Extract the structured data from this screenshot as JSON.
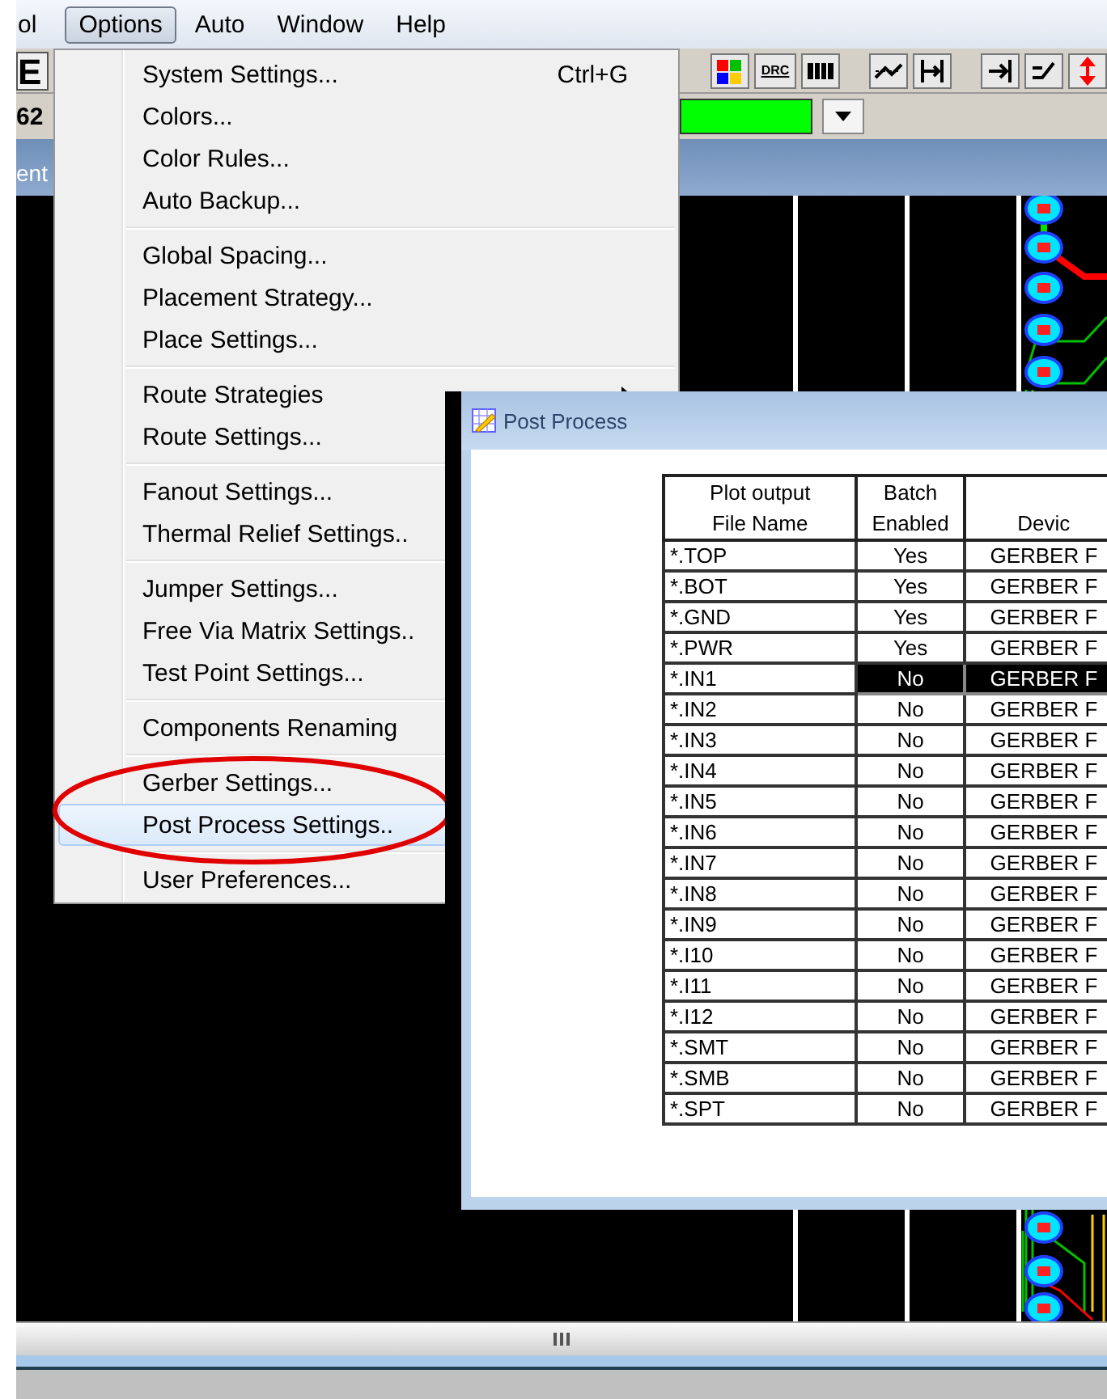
{
  "menubar": [
    {
      "label": "ol",
      "selected": false
    },
    {
      "label": "Options",
      "selected": true
    },
    {
      "label": "Auto",
      "selected": false
    },
    {
      "label": "Window",
      "selected": false
    },
    {
      "label": "Help",
      "selected": false
    }
  ],
  "toolbar": {
    "left_label": "E",
    "drc_label": "DRC"
  },
  "toolbar2": {
    "left_label": "62"
  },
  "document_tab": "ent",
  "options_menu": {
    "groups": [
      [
        {
          "label": "System Settings...",
          "shortcut": "Ctrl+G",
          "submenu": false,
          "selected": false
        },
        {
          "label": "Colors...",
          "submenu": false,
          "selected": false
        },
        {
          "label": "Color Rules...",
          "submenu": false,
          "selected": false
        },
        {
          "label": "Auto Backup...",
          "submenu": false,
          "selected": false
        }
      ],
      [
        {
          "label": "Global Spacing...",
          "submenu": false,
          "selected": false
        },
        {
          "label": "Placement Strategy...",
          "submenu": false,
          "selected": false
        },
        {
          "label": "Place Settings...",
          "submenu": false,
          "selected": false
        }
      ],
      [
        {
          "label": "Route Strategies",
          "submenu": true,
          "selected": false
        },
        {
          "label": "Route Settings...",
          "submenu": false,
          "selected": false
        }
      ],
      [
        {
          "label": "Fanout Settings...",
          "submenu": false,
          "selected": false
        },
        {
          "label": "Thermal Relief Settings..",
          "submenu": false,
          "selected": false
        }
      ],
      [
        {
          "label": "Jumper Settings...",
          "submenu": false,
          "selected": false
        },
        {
          "label": "Free Via Matrix Settings..",
          "submenu": false,
          "selected": false
        },
        {
          "label": "Test Point Settings...",
          "submenu": false,
          "selected": false
        }
      ],
      [
        {
          "label": "Components Renaming",
          "submenu": false,
          "selected": false
        }
      ],
      [
        {
          "label": "Gerber Settings...",
          "submenu": false,
          "selected": false
        },
        {
          "label": "Post Process Settings..",
          "submenu": false,
          "selected": true
        }
      ],
      [
        {
          "label": "User Preferences...",
          "submenu": false,
          "selected": false
        }
      ]
    ]
  },
  "dialog": {
    "title": "Post Process",
    "table": {
      "columns": [
        [
          "Plot output",
          "File Name"
        ],
        [
          "Batch",
          "Enabled"
        ],
        [
          "Devic"
        ]
      ],
      "rows": [
        {
          "file": "*.TOP",
          "batch": "Yes",
          "device": "GERBER F",
          "selected": false
        },
        {
          "file": "*.BOT",
          "batch": "Yes",
          "device": "GERBER F",
          "selected": false
        },
        {
          "file": "*.GND",
          "batch": "Yes",
          "device": "GERBER F",
          "selected": false
        },
        {
          "file": "*.PWR",
          "batch": "Yes",
          "device": "GERBER F",
          "selected": false
        },
        {
          "file": "*.IN1",
          "batch": "No",
          "device": "GERBER F",
          "selected": true
        },
        {
          "file": "*.IN2",
          "batch": "No",
          "device": "GERBER F",
          "selected": false
        },
        {
          "file": "*.IN3",
          "batch": "No",
          "device": "GERBER F",
          "selected": false
        },
        {
          "file": "*.IN4",
          "batch": "No",
          "device": "GERBER F",
          "selected": false
        },
        {
          "file": "*.IN5",
          "batch": "No",
          "device": "GERBER F",
          "selected": false
        },
        {
          "file": "*.IN6",
          "batch": "No",
          "device": "GERBER F",
          "selected": false
        },
        {
          "file": "*.IN7",
          "batch": "No",
          "device": "GERBER F",
          "selected": false
        },
        {
          "file": "*.IN8",
          "batch": "No",
          "device": "GERBER F",
          "selected": false
        },
        {
          "file": "*.IN9",
          "batch": "No",
          "device": "GERBER F",
          "selected": false
        },
        {
          "file": "*.I10",
          "batch": "No",
          "device": "GERBER F",
          "selected": false
        },
        {
          "file": "*.I11",
          "batch": "No",
          "device": "GERBER F",
          "selected": false
        },
        {
          "file": "*.I12",
          "batch": "No",
          "device": "GERBER F",
          "selected": false
        },
        {
          "file": "*.SMT",
          "batch": "No",
          "device": "GERBER F",
          "selected": false
        },
        {
          "file": "*.SMB",
          "batch": "No",
          "device": "GERBER F",
          "selected": false
        },
        {
          "file": "*.SPT",
          "batch": "No",
          "device": "GERBER F",
          "selected": false
        }
      ]
    }
  }
}
